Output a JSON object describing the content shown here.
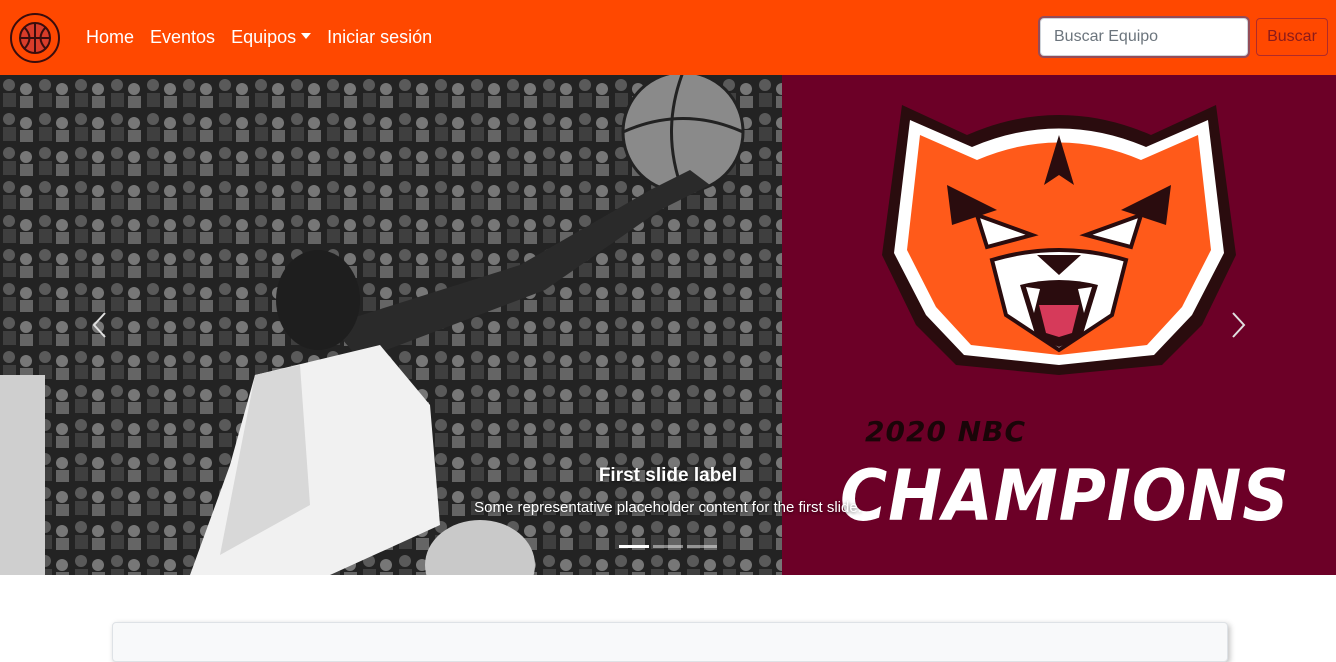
{
  "navbar": {
    "brand_icon": "basketball-icon",
    "links": [
      "Home",
      "Eventos",
      "Equipos",
      "Iniciar sesión"
    ],
    "search_placeholder": "Buscar Equipo",
    "search_button": "Buscar",
    "background": "#ff4800"
  },
  "carousel": {
    "caption_title": "First slide label",
    "caption_text": "Some representative placeholder content for the first slide.",
    "indicators": [
      true,
      false,
      false
    ],
    "logo_background": "#6c0027",
    "logo_line1": "2020 NBC",
    "logo_line2": "CHAMPIONS",
    "prev_icon": "chevron-left-icon",
    "next_icon": "chevron-right-icon"
  }
}
